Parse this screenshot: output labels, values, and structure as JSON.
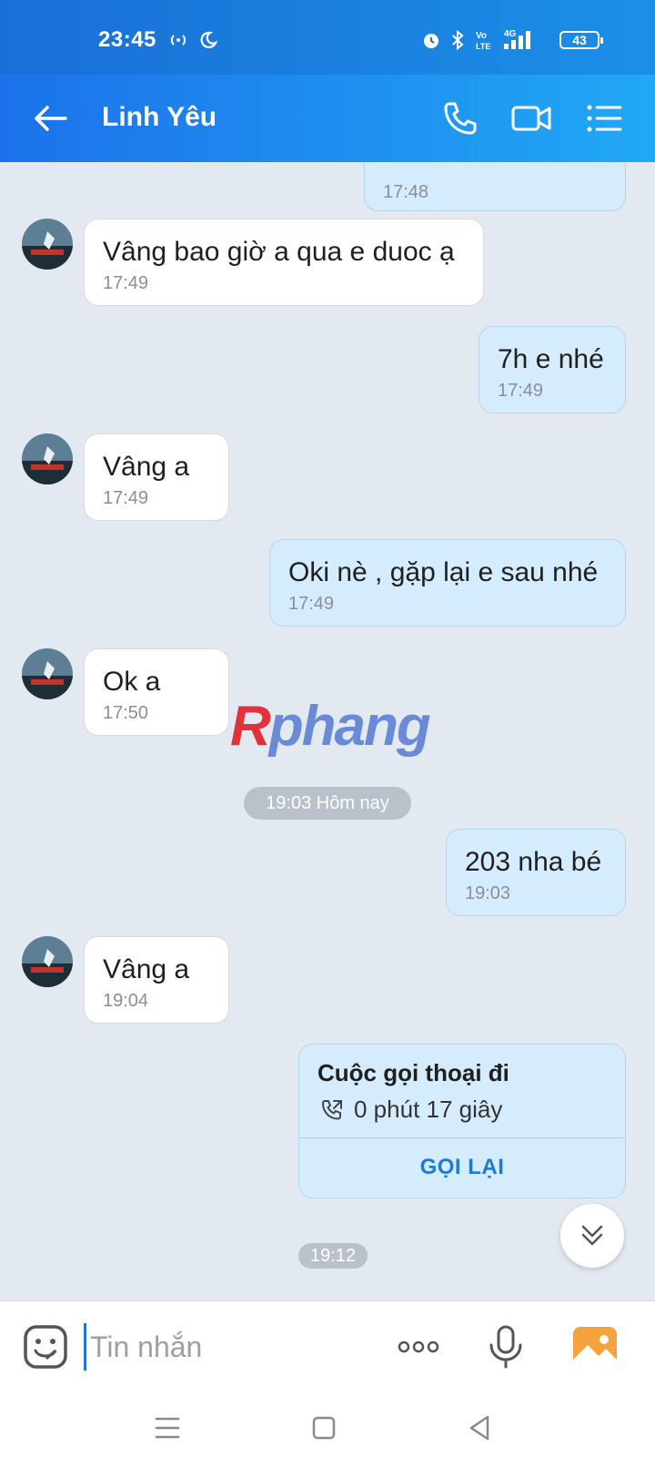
{
  "status_bar": {
    "time": "23:45",
    "battery": "43"
  },
  "header": {
    "title": "Linh Yêu"
  },
  "messages": [
    {
      "dir": "out",
      "text": "",
      "time": "17:48"
    },
    {
      "dir": "in",
      "text": "Vâng bao giờ a qua e duoc ạ",
      "time": "17:49"
    },
    {
      "dir": "out",
      "text": "7h e nhé",
      "time": "17:49"
    },
    {
      "dir": "in",
      "text": "Vâng a",
      "time": "17:49"
    },
    {
      "dir": "out",
      "text": "Oki nè , gặp lại e sau nhé",
      "time": "17:49"
    },
    {
      "dir": "in",
      "text": "Ok a",
      "time": "17:50"
    },
    {
      "dir": "out",
      "text": "203 nha bé",
      "time": "19:03"
    },
    {
      "dir": "in",
      "text": "Vâng a",
      "time": "19:04"
    }
  ],
  "date_separator": "19:03 Hôm nay",
  "call": {
    "title": "Cuộc gọi thoại đi",
    "duration": "0 phút 17 giây",
    "action": "GỌI LẠI",
    "time": "19:12"
  },
  "watermark": "Rphang",
  "input": {
    "placeholder": "Tin nhắn"
  },
  "colors": {
    "header": "#1c72ea",
    "accent": "#1b7ad9",
    "outgoing_bubble": "#d4ecfd",
    "background": "#e2e9f1"
  },
  "icons": [
    "back-arrow-icon",
    "phone-icon",
    "video-call-icon",
    "menu-list-icon",
    "emoji-icon",
    "more-icon",
    "microphone-icon",
    "image-icon",
    "chevron-double-down-icon"
  ]
}
